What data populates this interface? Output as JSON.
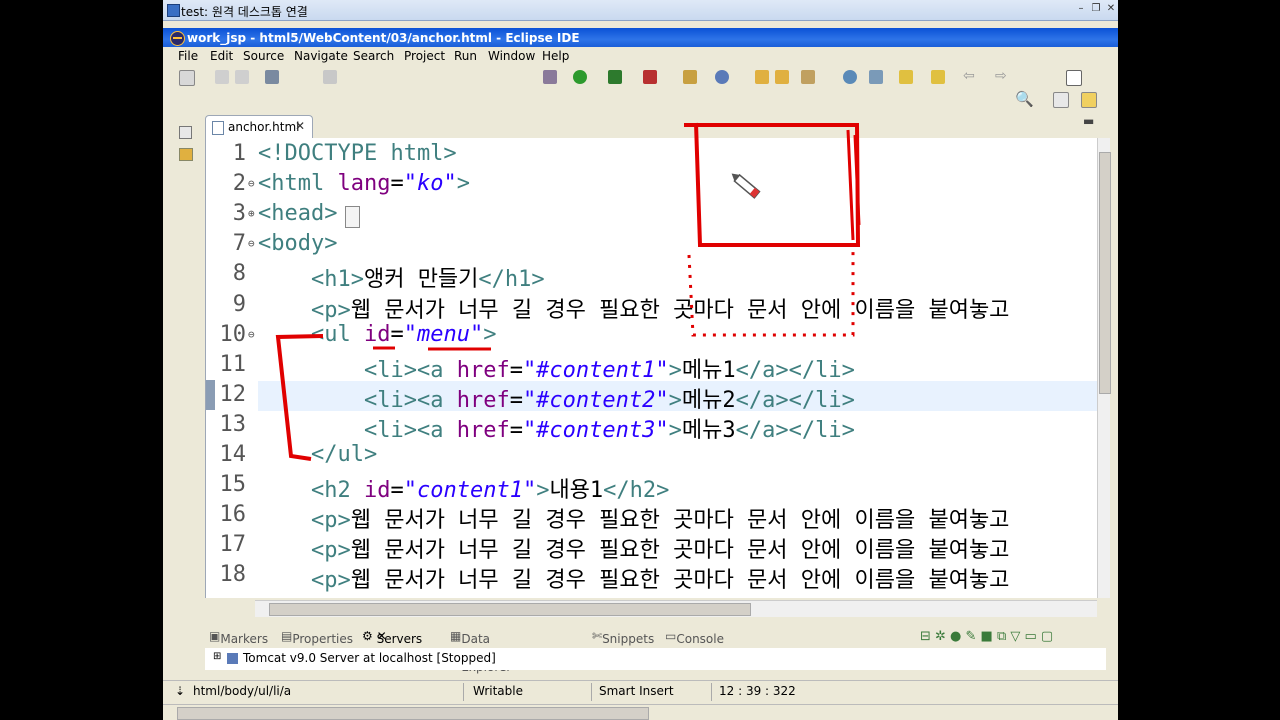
{
  "rdp": {
    "title": "test: 원격 데스크톱 연결"
  },
  "window": {
    "title": "work_jsp - html5/WebContent/03/anchor.html - Eclipse IDE"
  },
  "menu": [
    "File",
    "Edit",
    "Source",
    "Navigate",
    "Search",
    "Project",
    "Run",
    "Window",
    "Help"
  ],
  "editor": {
    "tab_label": "anchor.html",
    "lines": [
      {
        "n": "1",
        "fold": "",
        "html": "<span class=\"tag\">&lt;!DOCTYPE html&gt;</span>"
      },
      {
        "n": "2",
        "fold": "⊖",
        "html": "<span class=\"tag\">&lt;html</span> <span class=\"attr\">lang</span>=<span class=\"val\">\"ko\"</span><span class=\"tag\">&gt;</span>"
      },
      {
        "n": "3",
        "fold": "⊕",
        "html": "<span class=\"tag\">&lt;head&gt;</span>"
      },
      {
        "n": "7",
        "fold": "⊖",
        "html": "<span class=\"tag\">&lt;body&gt;</span>"
      },
      {
        "n": "8",
        "fold": "",
        "html": "    <span class=\"tag\">&lt;h1&gt;</span>앵커 만들기<span class=\"tag\">&lt;/h1&gt;</span>"
      },
      {
        "n": "9",
        "fold": "",
        "html": "    <span class=\"tag\">&lt;p&gt;</span>웹 문서가 너무 길 경우 필요한 곳마다 문서 안에 이름을 붙여놓고"
      },
      {
        "n": "10",
        "fold": "⊖",
        "html": "    <span class=\"tag\">&lt;ul</span> <span class=\"attr\">id</span>=<span class=\"val\">\"menu\"</span><span class=\"tag\">&gt;</span>"
      },
      {
        "n": "11",
        "fold": "",
        "html": "        <span class=\"tag\">&lt;li&gt;&lt;a</span> <span class=\"attr\">href</span>=<span class=\"val\">\"#content1\"</span><span class=\"tag\">&gt;</span>메뉴1<span class=\"tag\">&lt;/a&gt;&lt;/li&gt;</span>"
      },
      {
        "n": "12",
        "fold": "",
        "html": "        <span class=\"tag\">&lt;li&gt;&lt;a</span> <span class=\"attr\">href</span>=<span class=\"val\">\"#content2\"</span><span class=\"tag\">&gt;</span>메뉴2<span class=\"tag\">&lt;/a&gt;&lt;/li&gt;</span>"
      },
      {
        "n": "13",
        "fold": "",
        "html": "        <span class=\"tag\">&lt;li&gt;&lt;a</span> <span class=\"attr\">href</span>=<span class=\"val\">\"#content3\"</span><span class=\"tag\">&gt;</span>메뉴3<span class=\"tag\">&lt;/a&gt;&lt;/li&gt;</span>"
      },
      {
        "n": "14",
        "fold": "",
        "html": "    <span class=\"tag\">&lt;/ul&gt;</span>"
      },
      {
        "n": "15",
        "fold": "",
        "html": "    <span class=\"tag\">&lt;h2</span> <span class=\"attr\">id</span>=<span class=\"val\">\"content1\"</span><span class=\"tag\">&gt;</span>내용1<span class=\"tag\">&lt;/h2&gt;</span>"
      },
      {
        "n": "16",
        "fold": "",
        "html": "    <span class=\"tag\">&lt;p&gt;</span>웹 문서가 너무 길 경우 필요한 곳마다 문서 안에 이름을 붙여놓고"
      },
      {
        "n": "17",
        "fold": "",
        "html": "    <span class=\"tag\">&lt;p&gt;</span>웹 문서가 너무 길 경우 필요한 곳마다 문서 안에 이름을 붙여놓고"
      },
      {
        "n": "18",
        "fold": "",
        "html": "    <span class=\"tag\">&lt;p&gt;</span>웹 문서가 너무 길 경우 필요한 곳마다 문서 안에 이름을 붙여놓고"
      }
    ]
  },
  "bottom_tabs": {
    "markers": "Markers",
    "properties": "Properties",
    "servers": "Servers",
    "dse": "Data Source Explorer",
    "snippets": "Snippets",
    "console": "Console"
  },
  "server": {
    "label": "Tomcat v9.0 Server at localhost  [Stopped]"
  },
  "status": {
    "path": "html/body/ul/li/a",
    "mode": "Writable",
    "insert": "Smart Insert",
    "position": "12 : 39 : 322"
  },
  "colors": {
    "annotation": "#e00000",
    "tag": "#3f7f7f",
    "attr": "#7f007f",
    "value": "#2a00ff",
    "title_bar": "#0a52d6"
  }
}
